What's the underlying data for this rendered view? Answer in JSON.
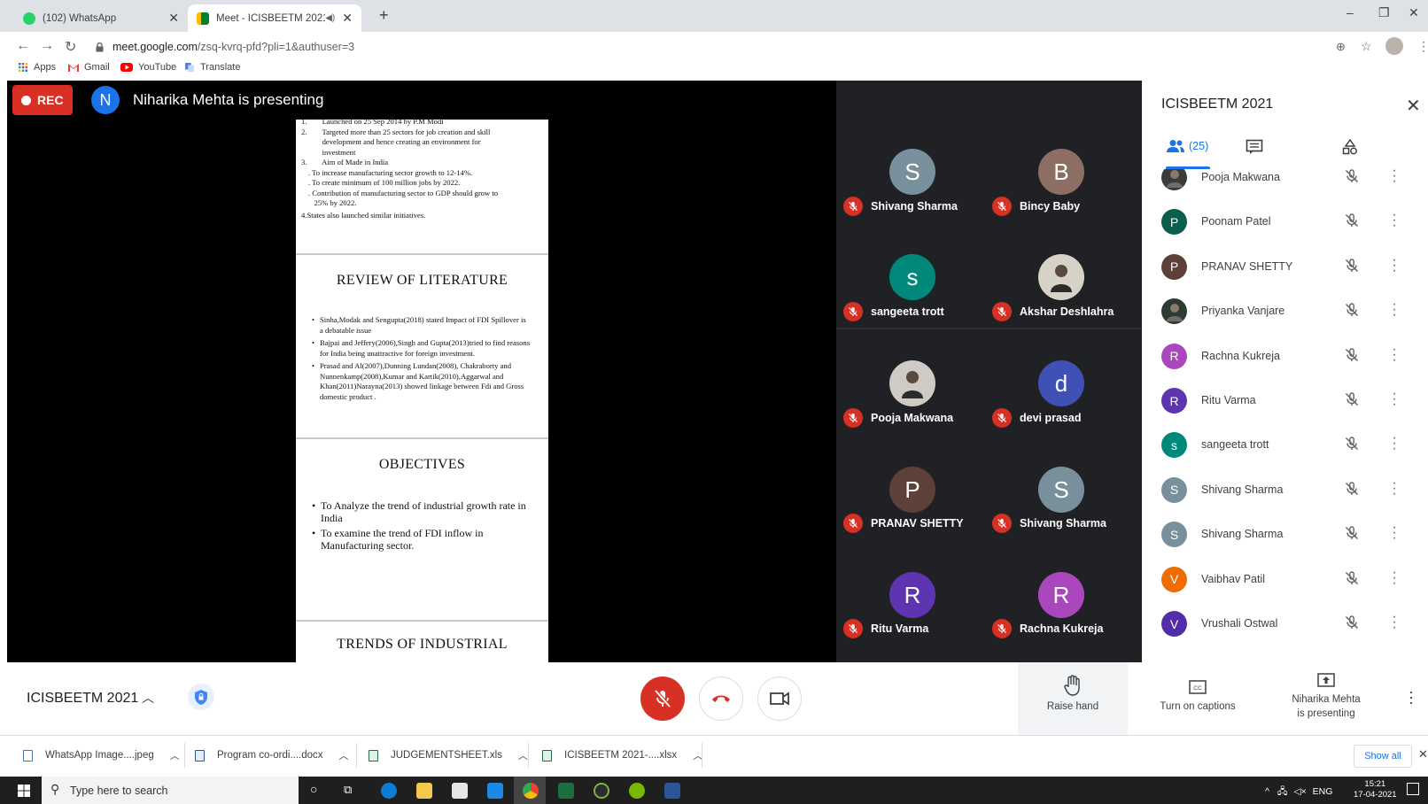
{
  "browser": {
    "tabs": [
      {
        "label": "(102) WhatsApp",
        "active": false,
        "favicon": "whatsapp-icon"
      },
      {
        "label": "Meet - ICISBEETM 2021",
        "active": true,
        "favicon": "meet-icon"
      }
    ],
    "url_host": "meet.google.com",
    "url_path": "/zsq-kvrq-pfd?pli=1&authuser=3",
    "bookmarks": [
      "Apps",
      "Gmail",
      "YouTube",
      "Translate"
    ]
  },
  "meet": {
    "rec_label": "REC",
    "presenter_initial": "N",
    "presenter_text": "Niharika Mehta is presenting",
    "slides": {
      "s1": [
        "1.        Launched on 25 Sep 2014 by P.M Modi",
        "2.        Targeted more than 25 sectors for job creation and skill",
        "           development and hence creating an environment for",
        "           investment",
        "3.        Aim of Made in India",
        ". To increase manufacturing sector growth to 12-14%.",
        ". To create minimum of 100 million jobs by 2022.",
        ". Contribution of manufacturing sector to GDP should grow to",
        "   25% by 2022.",
        "4.States also launched similar initiatives."
      ],
      "s2_title": "REVIEW OF LITERATURE",
      "s2": [
        "Sinha,Modak and Sengupta(2018) stated Impact of FDI Spillover is a debatable issue",
        "Bajpai and Jeffery(2006),Singh and Gupta(2013)tried to find reasons for India being unattractive for foreign investment.",
        "Prasad and Al(2007),Dunning  Lundan(2008), Chakraborty and Nunnenkamp(2008),Kumar and Kartik(2010),Aggarwal and Khan(2011)Narayna(2013) showed linkage between  Fdi and Gross domestic product ."
      ],
      "s3_title": "OBJECTIVES",
      "s3": [
        "To Analyze the trend of industrial growth rate in India",
        "To examine the trend of FDI inflow in Manufacturing sector."
      ],
      "s4_title": "TRENDS OF INDUSTRIAL"
    },
    "tiles": [
      {
        "name": "Shivang Sharma",
        "initial": "S",
        "color": "#78909c"
      },
      {
        "name": "Bincy Baby",
        "initial": "B",
        "color": "#8d6e63"
      },
      {
        "name": "sangeeta trott",
        "initial": "s",
        "color": "#00897b"
      },
      {
        "name": "Akshar Deshlahra",
        "initial": "",
        "color": "#d7d2c8"
      },
      {
        "name": "Pooja Makwana",
        "initial": "",
        "color": "#cfcac4"
      },
      {
        "name": "devi prasad",
        "initial": "d",
        "color": "#3f51b5"
      },
      {
        "name": "PRANAV SHETTY",
        "initial": "P",
        "color": "#5d4037"
      },
      {
        "name": "Shivang Sharma",
        "initial": "S",
        "color": "#78909c"
      },
      {
        "name": "Ritu Varma",
        "initial": "R",
        "color": "#5e35b1"
      },
      {
        "name": "Rachna Kukreja",
        "initial": "R",
        "color": "#ab47bc"
      }
    ]
  },
  "panel": {
    "title": "ICISBEETM 2021",
    "people_count": "(25)",
    "participants": [
      {
        "name": "Pooja Makwana",
        "initial": "",
        "color": "#3b3b3b"
      },
      {
        "name": "Poonam Patel",
        "initial": "P",
        "color": "#0b5e4d"
      },
      {
        "name": "PRANAV SHETTY",
        "initial": "P",
        "color": "#5d4037"
      },
      {
        "name": "Priyanka Vanjare",
        "initial": "",
        "color": "#2e3b32"
      },
      {
        "name": "Rachna Kukreja",
        "initial": "R",
        "color": "#ab47bc"
      },
      {
        "name": "Ritu Varma",
        "initial": "R",
        "color": "#5e35b1"
      },
      {
        "name": "sangeeta trott",
        "initial": "s",
        "color": "#00897b"
      },
      {
        "name": "Shivang Sharma",
        "initial": "S",
        "color": "#78909c"
      },
      {
        "name": "Shivang Sharma",
        "initial": "S",
        "color": "#78909c"
      },
      {
        "name": "Vaibhav Patil",
        "initial": "V",
        "color": "#ef6c00"
      },
      {
        "name": "Vrushali Ostwal",
        "initial": "V",
        "color": "#512da8"
      }
    ]
  },
  "controls": {
    "meeting_title": "ICISBEETM 2021",
    "raise_hand": "Raise hand",
    "captions": "Turn on captions",
    "presenting_line1": "Niharika Mehta",
    "presenting_line2": "is presenting"
  },
  "downloads": {
    "items": [
      "WhatsApp Image....jpeg",
      "Program co-ordi....docx",
      "JUDGEMENTSHEET.xls",
      "ICISBEETM 2021-....xlsx"
    ],
    "show_all": "Show all"
  },
  "taskbar": {
    "search_placeholder": "Type here to search",
    "lang": "ENG",
    "time": "15:21",
    "date": "17-04-2021"
  }
}
